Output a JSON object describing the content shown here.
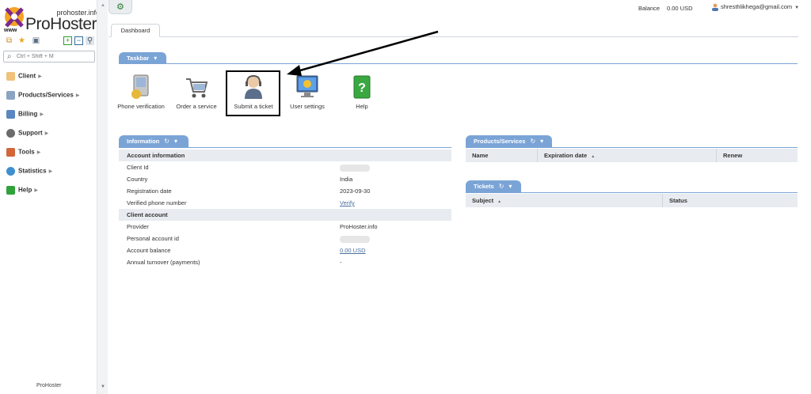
{
  "logo": {
    "site": "prohoster.info",
    "brand": "ProHoster",
    "www": "www"
  },
  "search": {
    "placeholder": "Ctrl + Shift + M"
  },
  "sidebar": {
    "items": [
      {
        "label": "Client",
        "icon": "client-icon"
      },
      {
        "label": "Products/Services",
        "icon": "cart-icon"
      },
      {
        "label": "Billing",
        "icon": "billing-icon"
      },
      {
        "label": "Support",
        "icon": "headset-icon"
      },
      {
        "label": "Tools",
        "icon": "tools-icon"
      },
      {
        "label": "Statistics",
        "icon": "globe-icon"
      },
      {
        "label": "Help",
        "icon": "help-icon"
      }
    ],
    "footer": "ProHoster"
  },
  "topbar": {
    "balance_label": "Balance",
    "balance_value": "0.00 USD",
    "user_email": "shresthlikhega@gmail.com"
  },
  "tabs": [
    {
      "label": "Dashboard"
    }
  ],
  "taskbar": {
    "title": "Taskbar",
    "items": [
      {
        "label": "Phone verification",
        "icon": "phone-verification-icon"
      },
      {
        "label": "Order a service",
        "icon": "shopping-cart-icon"
      },
      {
        "label": "Submit a ticket",
        "icon": "support-agent-icon"
      },
      {
        "label": "User settings",
        "icon": "monitor-settings-icon"
      },
      {
        "label": "Help",
        "icon": "help-book-icon"
      }
    ]
  },
  "information": {
    "title": "Information",
    "groups": [
      {
        "label": "Account information"
      },
      {
        "label": "Client account"
      }
    ],
    "rows": [
      {
        "key": "Client Id",
        "value": ""
      },
      {
        "key": "Country",
        "value": "India"
      },
      {
        "key": "Registration date",
        "value": "2023-09-30"
      },
      {
        "key": "Verified phone number",
        "value": "Verify"
      },
      {
        "key": "Provider",
        "value": "ProHoster.info"
      },
      {
        "key": "Personal account id",
        "value": ""
      },
      {
        "key": "Account balance",
        "value": "0.00 USD"
      },
      {
        "key": "Annual turnover (payments)",
        "value": "-"
      }
    ]
  },
  "products": {
    "title": "Products/Services",
    "columns": [
      "Name",
      "Expiration date",
      "Renew"
    ]
  },
  "tickets": {
    "title": "Tickets",
    "columns": [
      "Subject",
      "Status"
    ]
  },
  "colors": {
    "accent": "#7ba4d6",
    "highlight_border": "#000000",
    "link": "#4a6f9e"
  }
}
